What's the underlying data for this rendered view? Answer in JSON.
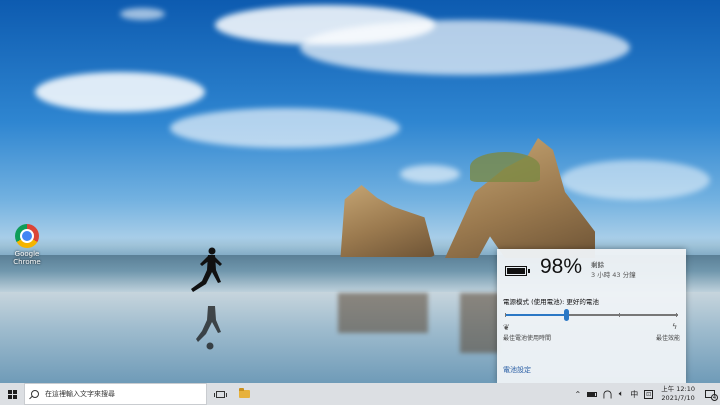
{
  "desktop": {
    "icons": [
      {
        "label": "Google Chrome",
        "icon": "chrome-icon"
      }
    ]
  },
  "battery_flyout": {
    "percent": "98%",
    "remaining_label": "剩餘",
    "remaining_time": "3 小時 43 分鐘",
    "power_mode": "電源模式 (使用電池): 更好的電池",
    "slider": {
      "left_label": "最佳電池使用時間",
      "right_label": "最佳效能",
      "value_fraction": 0.35
    },
    "battery_level_fraction": 0.98,
    "settings_link": "電池設定"
  },
  "taskbar": {
    "search_placeholder": "在這裡輸入文字來搜尋",
    "tray": {
      "ime_mode": "中",
      "ime_badge": "⊡",
      "time": "上午 12:10",
      "date": "2021/7/10",
      "notification_count": "4"
    }
  },
  "colors": {
    "accent": "#2b78c5",
    "link": "#2b5fa5",
    "taskbar_bg": "#dcdfe3"
  }
}
